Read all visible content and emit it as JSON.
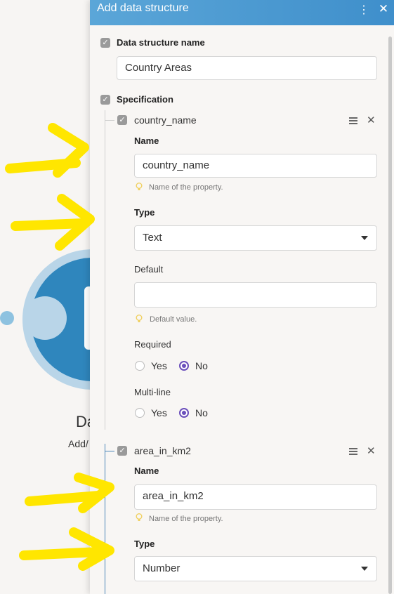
{
  "background": {
    "module_label_1": "Da",
    "module_label_2": "Add/"
  },
  "panel": {
    "title": "Add data structure",
    "menu_icon": "kebab-menu-icon",
    "close_icon": "close-icon",
    "name_section_label": "Data structure name",
    "name_value": "Country Areas",
    "spec_section_label": "Specification"
  },
  "items": [
    {
      "header": "country_name",
      "name_label": "Name",
      "name_value": "country_name",
      "name_hint": "Name of the property.",
      "type_label": "Type",
      "type_value": "Text",
      "default_label": "Default",
      "default_value": "",
      "default_hint": "Default value.",
      "required_label": "Required",
      "required_yes": "Yes",
      "required_no": "No",
      "required_selected": "No",
      "multiline_label": "Multi-line",
      "multiline_yes": "Yes",
      "multiline_no": "No",
      "multiline_selected": "No"
    },
    {
      "header": "area_in_km2",
      "name_label": "Name",
      "name_value": "area_in_km2",
      "name_hint": "Name of the property.",
      "type_label": "Type",
      "type_value": "Number"
    }
  ],
  "colors": {
    "header_blue": "#3f8fcb",
    "radio_purple": "#6b4fbb",
    "annotation_yellow": "#ffe600"
  }
}
